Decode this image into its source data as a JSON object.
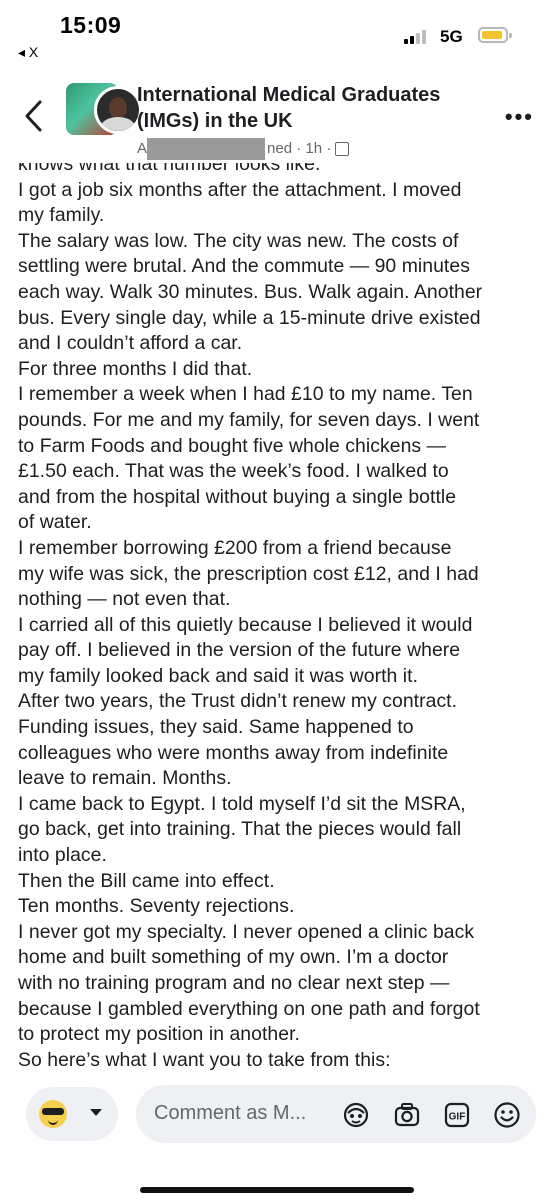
{
  "status_bar": {
    "time": "15:09",
    "back_app_label": "◂ X",
    "network": "5G",
    "battery_color": "#f4c430"
  },
  "header": {
    "group_name": "International Medical Graduates (IMGs) in the UK",
    "meta_author_partial": "A",
    "meta_suffix": "ned · 1h ·",
    "more_label": "•••"
  },
  "post": {
    "lines": [
      "knows what that number looks like.",
      "I got a job six months after the attachment. I moved",
      "my family.",
      "The salary was low. The city was new. The costs of",
      "settling were brutal. And the commute — 90 minutes",
      "each way. Walk 30 minutes. Bus. Walk again. Another",
      "bus. Every single day, while a 15-minute drive existed",
      "and I couldn’t afford a car.",
      "For three months I did that.",
      "I remember a week when I had £10 to my name. Ten",
      "pounds. For me and my family, for seven days. I went",
      "to Farm Foods and bought five whole chickens —",
      "£1.50 each. That was the week’s food. I walked to",
      "and from the hospital without buying a single bottle",
      "of water.",
      "I remember borrowing £200 from a friend because",
      "my wife was sick, the prescription cost £12, and I had",
      "nothing — not even that.",
      "I carried all of this quietly because I believed it would",
      "pay off. I believed in the version of the future where",
      "my family looked back and said it was worth it.",
      "After two years, the Trust didn’t renew my contract.",
      "Funding issues, they said. Same happened to",
      "colleagues who were months away from indefinite",
      "leave to remain. Months.",
      "I came back to Egypt. I told myself I’d sit the MSRA,",
      "go back, get into training. That the pieces would fall",
      "into place.",
      "Then the Bill came into effect.",
      "Ten months. Seventy rejections.",
      "I never got my specialty. I never opened a clinic back",
      "home and built something of my own. I’m a doctor",
      "with no training program and no clear next step —",
      "because I gambled everything on one path and forgot",
      "to protect my position in another.",
      "So here’s what I want you to take from this:"
    ]
  },
  "comment_bar": {
    "placeholder": "Comment as M...",
    "icons": [
      "avatar-sticker-icon",
      "camera-icon",
      "gif-icon",
      "emoji-icon"
    ]
  }
}
